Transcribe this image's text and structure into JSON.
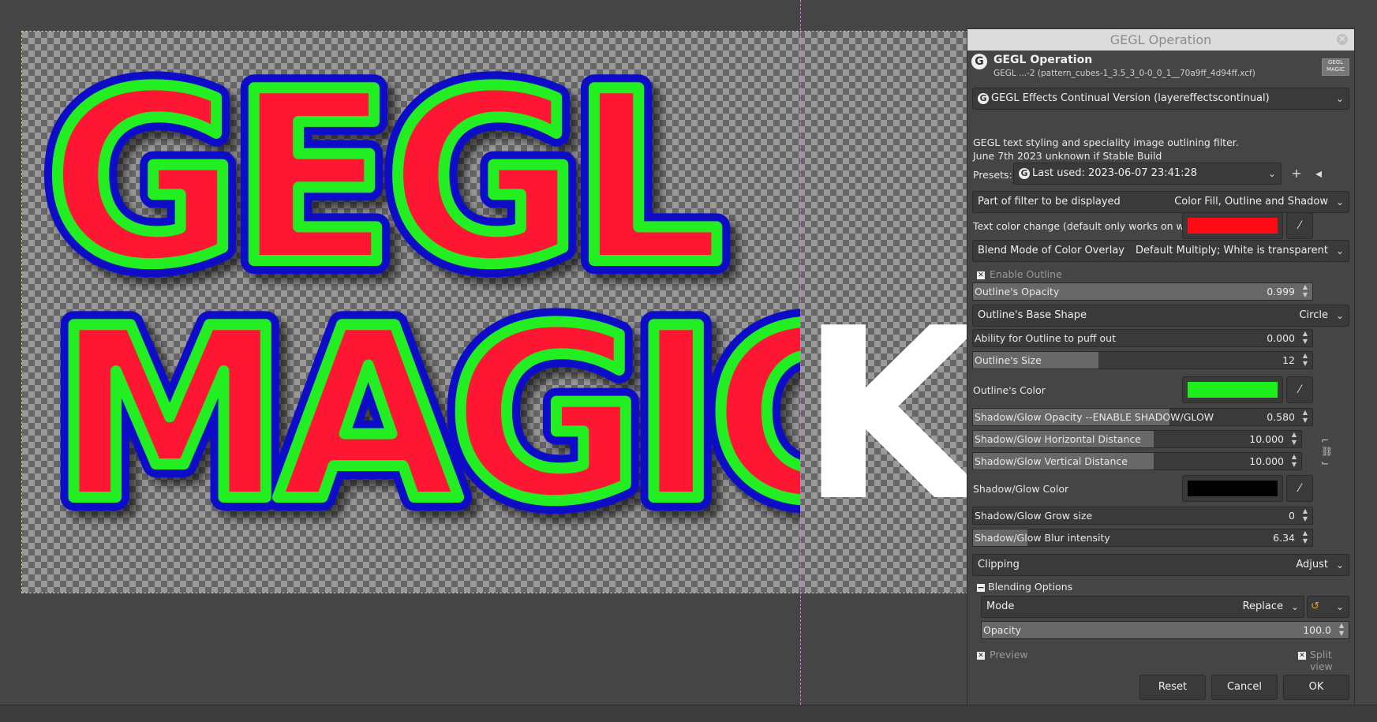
{
  "canvas": {
    "text_line1": "GEGL",
    "text_line2": "MAGIC",
    "split_char": "K"
  },
  "dialog": {
    "title": "GEGL Operation",
    "header_name": "GEGL Operation",
    "header_sub": "GEGL ...-2 (pattern_cubes-1_3.5_3_0-0_0_1__70a9ff_4d94ff.xcf)",
    "thumb_text": "GEGL MAGIC",
    "operation": "GEGL Effects Continual Version (layereffectscontinual)",
    "description_line1": "GEGL text styling and speciality image outlining filter.",
    "description_line2": "June 7th 2023 unknown if Stable Build",
    "presets_label": "Presets:",
    "presets_value": "Last used: 2023-06-07 23:41:28",
    "part_label": "Part of filter to be displayed",
    "part_value": "Color Fill, Outline and Shadow",
    "text_color_label": "Text color change (default only works on white text.)",
    "text_color": "#ff0a14",
    "blend_label": "Blend Mode of Color Overlay",
    "blend_value": "Default Multiply; White is transparent",
    "enable_outline": "Enable Outline",
    "outline_opacity_label": "Outline's Opacity",
    "outline_opacity": "0.999",
    "base_shape_label": "Outline's Base Shape",
    "base_shape_value": "Circle",
    "puff_label": "Ability for Outline to puff out",
    "puff_value": "0.000",
    "size_label": "Outline's Size",
    "size_value": "12",
    "outline_color_label": "Outline's Color",
    "outline_color": "#1ef01e",
    "shadow_opacity_label": "Shadow/Glow Opacity --ENABLE SHADOW/GLOW",
    "shadow_opacity": "0.580",
    "shadow_h_label": "Shadow/Glow Horizontal Distance",
    "shadow_h": "10.000",
    "shadow_v_label": "Shadow/Glow Vertical Distance",
    "shadow_v": "10.000",
    "shadow_color_label": "Shadow/Glow Color",
    "shadow_color": "#000000",
    "grow_label": "Shadow/Glow Grow size",
    "grow_value": "0",
    "blur_label": "Shadow/Glow Blur intensity",
    "blur_value": "6.34",
    "clipping_label": "Clipping",
    "clipping_value": "Adjust",
    "blending_options": "Blending Options",
    "mode_label": "Mode",
    "mode_value": "Replace",
    "opacity_label": "Opacity",
    "opacity_value": "100.0",
    "preview_label": "Preview",
    "split_view_label": "Split view",
    "reset": "Reset",
    "cancel": "Cancel",
    "ok": "OK"
  },
  "levels": {
    "outline_opacity": 0.999,
    "shadow_opacity": 0.58,
    "outline_size_fraction": 0.37,
    "shadow_h_fraction": 0.55,
    "shadow_v_fraction": 0.55,
    "blur_fraction": 0.16,
    "opacity_fraction": 1.0
  }
}
